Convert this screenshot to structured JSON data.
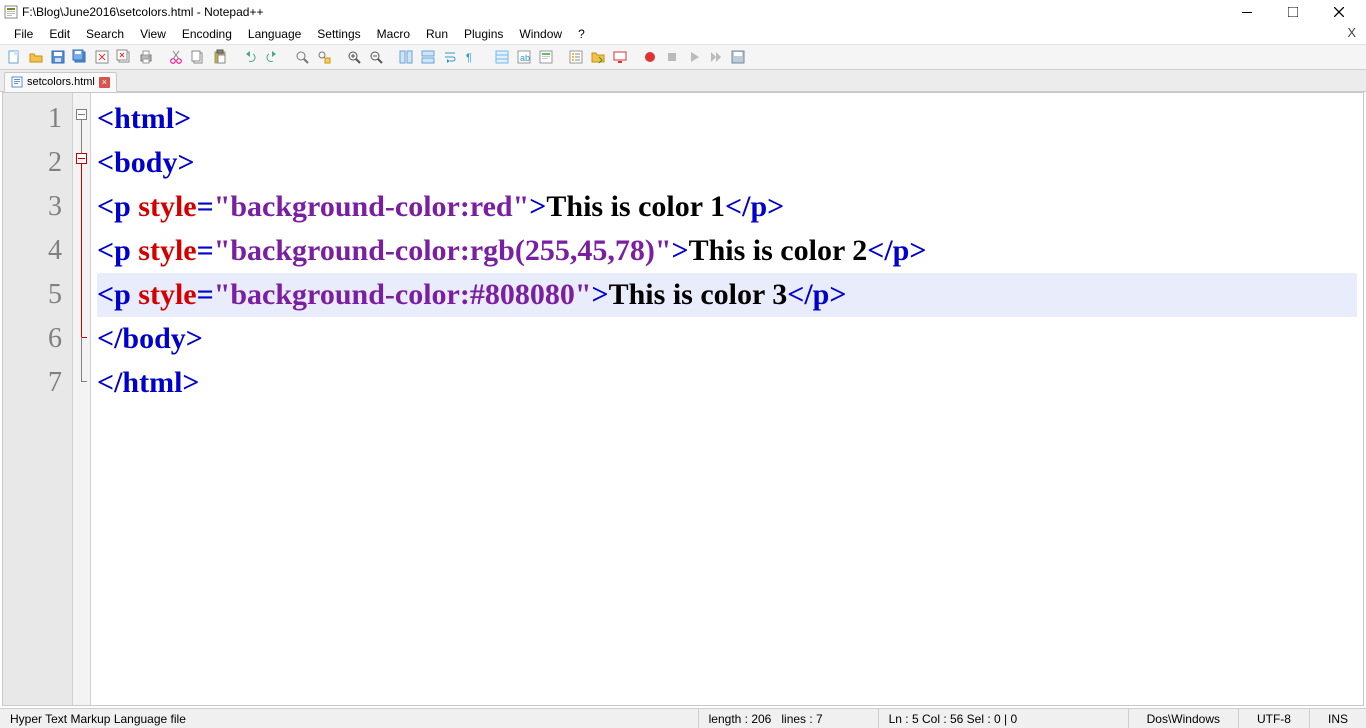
{
  "title": "F:\\Blog\\June2016\\setcolors.html - Notepad++",
  "menu": {
    "items": [
      "File",
      "Edit",
      "Search",
      "View",
      "Encoding",
      "Language",
      "Settings",
      "Macro",
      "Run",
      "Plugins",
      "Window",
      "?"
    ]
  },
  "tab": {
    "name": "setcolors.html"
  },
  "line_numbers": [
    "1",
    "2",
    "3",
    "4",
    "5",
    "6",
    "7"
  ],
  "code": {
    "l1": {
      "open": "<html>"
    },
    "l2": {
      "open": "<body>"
    },
    "l3": {
      "o1": "<p ",
      "attr": "style",
      "eq": "=",
      "str": "\"background-color:red\"",
      "o2": ">",
      "txt": "This is color 1",
      "cl": "</p>"
    },
    "l4": {
      "o1": "<p ",
      "attr": "style",
      "eq": "=",
      "str": "\"background-color:rgb(255,45,78)\"",
      "o2": ">",
      "txt": "This is color 2",
      "cl": "</p>"
    },
    "l5": {
      "o1": "<p ",
      "attr": "style",
      "eq": "=",
      "str": "\"background-color:#808080\"",
      "o2": ">",
      "txt": "This is color 3",
      "cl": "</p>"
    },
    "l6": {
      "close": "</body>"
    },
    "l7": {
      "close": "</html>"
    }
  },
  "status": {
    "type": "Hyper Text Markup Language file",
    "length": "length : 206",
    "lines": "lines : 7",
    "pos": "Ln : 5   Col : 56   Sel : 0 | 0",
    "eol": "Dos\\Windows",
    "encoding": "UTF-8",
    "mode": "INS"
  }
}
